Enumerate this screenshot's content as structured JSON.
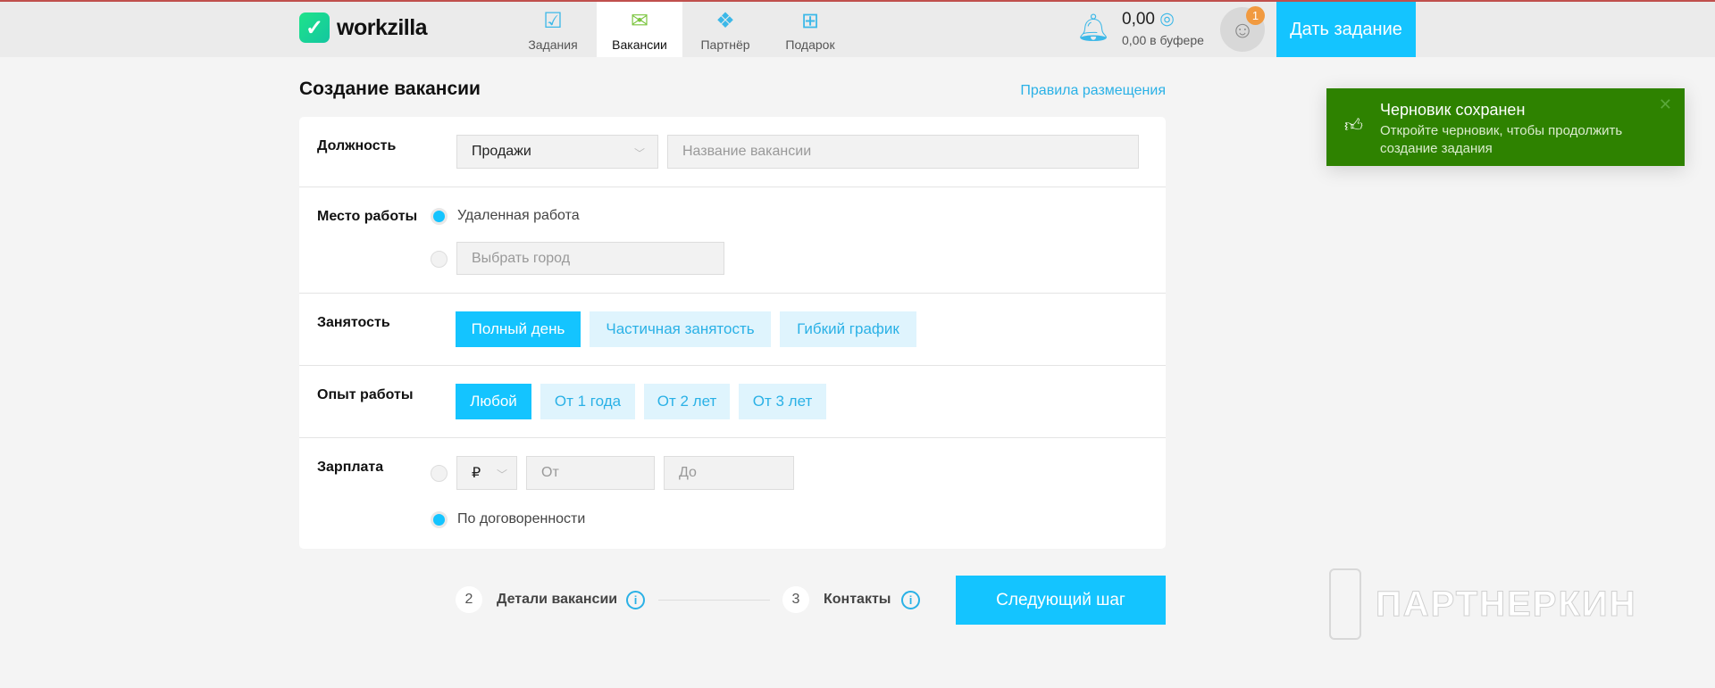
{
  "header": {
    "logo": "workzilla",
    "nav": [
      {
        "label": "Задания",
        "icon": "tasks-icon"
      },
      {
        "label": "Вакансии",
        "icon": "briefcase-icon"
      },
      {
        "label": "Партнёр",
        "icon": "handshake-icon"
      },
      {
        "label": "Подарок",
        "icon": "gift-icon"
      }
    ],
    "balance": "0,00",
    "buffer": "0,00 в буфере",
    "notifications": "1",
    "give_task": "Дать задание"
  },
  "page": {
    "title": "Создание вакансии",
    "rules_link": "Правила размещения"
  },
  "form": {
    "position": {
      "label": "Должность",
      "category": "Продажи",
      "name_placeholder": "Название вакансии"
    },
    "place": {
      "label": "Место работы",
      "remote": "Удаленная работа",
      "city_placeholder": "Выбрать город"
    },
    "employment": {
      "label": "Занятость",
      "options": [
        "Полный день",
        "Частичная занятость",
        "Гибкий график"
      ]
    },
    "experience": {
      "label": "Опыт работы",
      "options": [
        "Любой",
        "От 1 года",
        "От 2 лет",
        "От 3 лет"
      ]
    },
    "salary": {
      "label": "Зарплата",
      "currency": "₽",
      "from_placeholder": "От",
      "to_placeholder": "До",
      "negotiable": "По договоренности"
    }
  },
  "steps": [
    {
      "num": "2",
      "label": "Детали вакансии"
    },
    {
      "num": "3",
      "label": "Контакты"
    }
  ],
  "next_button": "Следующий шаг",
  "toast": {
    "title": "Черновик сохранен",
    "text": "Откройте черновик, чтобы продолжить создание задания"
  },
  "watermark": "ПАРТНЕРКИН",
  "colors": {
    "accent": "#14c4ff",
    "toast": "#2e8200"
  }
}
